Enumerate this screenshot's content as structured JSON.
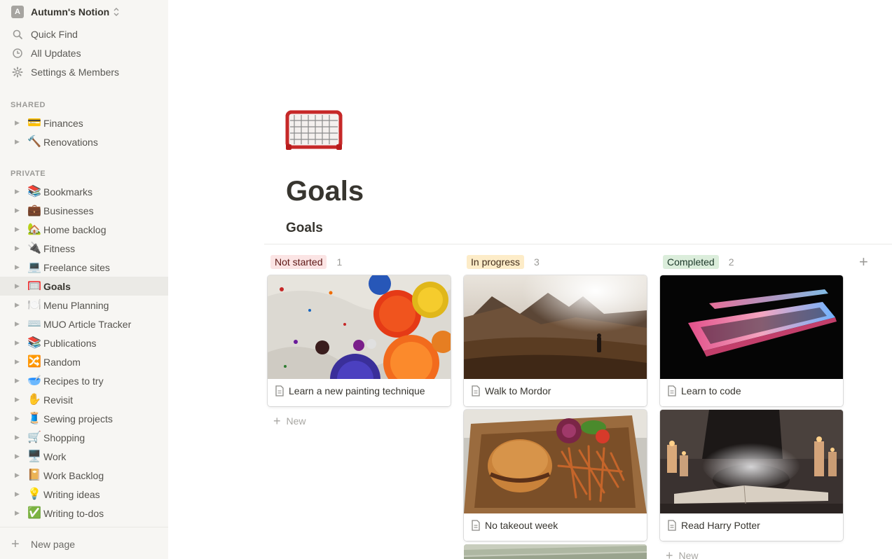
{
  "sidebar": {
    "workspace": {
      "avatar": "A",
      "name": "Autumn's Notion"
    },
    "nav": [
      {
        "label": "Quick Find",
        "icon": "search-icon"
      },
      {
        "label": "All Updates",
        "icon": "clock-icon"
      },
      {
        "label": "Settings & Members",
        "icon": "gear-icon"
      }
    ],
    "shared_title": "SHARED",
    "shared": [
      {
        "emoji": "💳",
        "label": "Finances"
      },
      {
        "emoji": "🔨",
        "label": "Renovations"
      }
    ],
    "private_title": "PRIVATE",
    "private": [
      {
        "emoji": "📚",
        "label": "Bookmarks"
      },
      {
        "emoji": "💼",
        "label": "Businesses"
      },
      {
        "emoji": "🏡",
        "label": "Home backlog"
      },
      {
        "emoji": "🔌",
        "label": "Fitness"
      },
      {
        "emoji": "💻",
        "label": "Freelance sites"
      },
      {
        "emoji": "🥅",
        "label": "Goals",
        "active": true
      },
      {
        "emoji": "🍽️",
        "label": "Menu Planning"
      },
      {
        "emoji": "⌨️",
        "label": "MUO Article Tracker"
      },
      {
        "emoji": "📚",
        "label": "Publications"
      },
      {
        "emoji": "🔀",
        "label": "Random"
      },
      {
        "emoji": "🥣",
        "label": "Recipes to try"
      },
      {
        "emoji": "✋",
        "label": "Revisit"
      },
      {
        "emoji": "🧵",
        "label": "Sewing projects"
      },
      {
        "emoji": "🛒",
        "label": "Shopping"
      },
      {
        "emoji": "🖥️",
        "label": "Work"
      },
      {
        "emoji": "📔",
        "label": "Work Backlog"
      },
      {
        "emoji": "💡",
        "label": "Writing ideas"
      },
      {
        "emoji": "✅",
        "label": "Writing to-dos"
      }
    ],
    "new_page": "New page"
  },
  "page": {
    "icon": "goal-net-icon",
    "title": "Goals",
    "database_title": "Goals"
  },
  "board": {
    "columns": [
      {
        "name": "Not started",
        "count": "1",
        "tag_bg": "#fbe4e4",
        "tag_color": "#5d1715",
        "cards": [
          {
            "title": "Learn a new painting technique",
            "cover": "paint-cans-image"
          }
        ],
        "new_label": "New"
      },
      {
        "name": "In progress",
        "count": "3",
        "tag_bg": "#fdecc8",
        "tag_color": "#402c1b",
        "cards": [
          {
            "title": "Walk to Mordor",
            "cover": "mountain-hiker-image"
          },
          {
            "title": "No takeout week",
            "cover": "burger-fries-image"
          }
        ]
      },
      {
        "name": "Completed",
        "count": "2",
        "tag_bg": "#dbeddb",
        "tag_color": "#1c3829",
        "cards": [
          {
            "title": "Learn to code",
            "cover": "laptop-image"
          },
          {
            "title": "Read Harry Potter",
            "cover": "cauldron-books-image"
          }
        ],
        "new_label": "New"
      }
    ]
  }
}
